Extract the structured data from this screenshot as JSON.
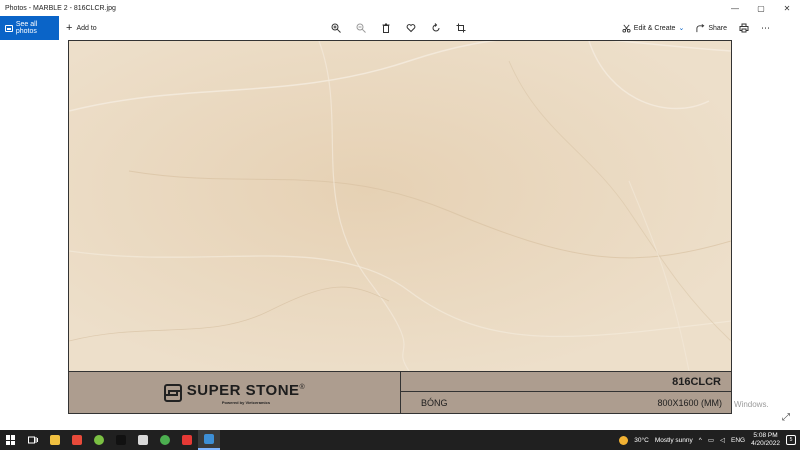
{
  "window": {
    "title": "Photos - MARBLE 2 - 816CLCR.jpg",
    "controls": {
      "minimize": "—",
      "maximize": "▢",
      "close": "✕"
    }
  },
  "toolbar": {
    "see_all": "See all photos",
    "add_to": "Add to",
    "edit_create": "Edit & Create",
    "share": "Share",
    "accent": "#0a64c8"
  },
  "tile": {
    "brand": "SUPER STONE",
    "registered": "®",
    "powered": "Powered by Vietceramics",
    "code": "816CLCR",
    "finish": "BÓNG",
    "size": "800X1600 (MM)",
    "marble_color": "#ead9c0",
    "band_color": "#ad9d8f"
  },
  "watermark": "Windows.",
  "taskbar": {
    "weather_temp": "30°C",
    "weather_desc": "Mostly sunny",
    "language": "ENG",
    "time": "5:08 PM",
    "date": "4/20/2022",
    "notifications": "5",
    "apps": [
      {
        "name": "file-explorer-icon",
        "color": "#f0c040"
      },
      {
        "name": "mail-app-icon",
        "color": "#e84a3a"
      },
      {
        "name": "android-app-icon",
        "color": "#7bc043"
      },
      {
        "name": "tiktok-icon",
        "color": "#111111"
      },
      {
        "name": "paint-app-icon",
        "color": "#d9d9d9"
      },
      {
        "name": "chrome-icon",
        "color": "#4caf50"
      },
      {
        "name": "vivaldi-icon",
        "color": "#e53935"
      },
      {
        "name": "photos-app-icon",
        "color": "#3d8fd6"
      }
    ]
  }
}
